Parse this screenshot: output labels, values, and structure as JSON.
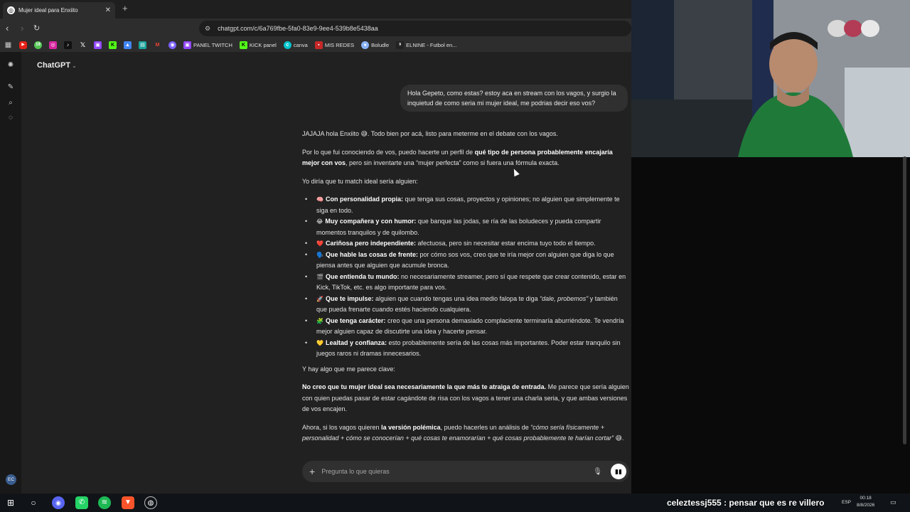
{
  "browser": {
    "tab_title": "Mujer ideal para Enxiito",
    "url": "chatgpt.com/c/6a769fbe-5fa0-83e9-9ee4-539b8e5438aa",
    "bookmarks": [
      {
        "label": "PANEL TWITCH"
      },
      {
        "label": "KICK panel"
      },
      {
        "label": "canva"
      },
      {
        "label": "MIS REDES"
      },
      {
        "label": "Boludle"
      },
      {
        "label": "ELNINE - Futbol en..."
      }
    ],
    "bookmark_icon_badge": "19"
  },
  "chat": {
    "model_name": "ChatGPT",
    "avatar_initials": "EC",
    "user_message": "Hola Gepeto, como estas? estoy aca en stream con los vagos, y surgio la inquietud de como seria mi mujer ideal, me podrias decir eso vos?",
    "answer": {
      "greeting": "JAJAJA hola Enxiito 😅. Todo bien por acá, listo para meterme en el debate con los vagos.",
      "intro_pre": "Por lo que fui conociendo de vos, puedo hacerte un perfil de ",
      "intro_bold": "qué tipo de persona probablemente encajaría mejor con vos",
      "intro_post": ", pero sin inventarte una “mujer perfecta” como si fuera una fórmula exacta.",
      "lead": "Yo diría que tu match ideal sería alguien:",
      "items": [
        {
          "emoji": "🧠",
          "title": "Con personalidad propia:",
          "text": " que tenga sus cosas, proyectos y opiniones; no alguien que simplemente te siga en todo."
        },
        {
          "emoji": "😂",
          "title": "Muy compañera y con humor:",
          "text": " que banque las jodas, se ría de las boludeces y pueda compartir momentos tranquilos y de quilombo."
        },
        {
          "emoji": "❤️",
          "title": "Cariñosa pero independiente:",
          "text": " afectuosa, pero sin necesitar estar encima tuyo todo el tiempo."
        },
        {
          "emoji": "🗣️",
          "title": "Que hable las cosas de frente:",
          "text": " por cómo sos vos, creo que te iría mejor con alguien que diga lo que piensa antes que alguien que acumule bronca."
        },
        {
          "emoji": "🎬",
          "title": "Que entienda tu mundo:",
          "text": " no necesariamente streamer, pero sí que respete que crear contenido, estar en Kick, TikTok, etc. es algo importante para vos."
        },
        {
          "emoji": "🚀",
          "title": "Que te impulse:",
          "text": " alguien que cuando tengas una idea medio falopa te diga ",
          "italic": "“dale, probemos”",
          "text2": " y también que pueda frenarte cuando estés haciendo cualquiera."
        },
        {
          "emoji": "🧩",
          "title": "Que tenga carácter:",
          "text": " creo que una persona demasiado complaciente terminaría aburriéndote. Te vendría mejor alguien capaz de discutirte una idea y hacerte pensar."
        },
        {
          "emoji": "💛",
          "title": "Lealtad y confianza:",
          "text": " esto probablemente sería de las cosas más importantes. Poder estar tranquilo sin juegos raros ni dramas innecesarios."
        }
      ],
      "key_line": "Y hay algo que me parece clave:",
      "key_bold": "No creo que tu mujer ideal sea necesariamente la que más te atraiga de entrada.",
      "key_rest": " Me parece que sería alguien con quien puedas pasar de estar cagándote de risa con los vagos a tener una charla seria, y que ambas versiones de vos encajen.",
      "closing_pre": "Ahora, si los vagos quieren ",
      "closing_bold": "la versión polémica",
      "closing_mid": ", puedo hacerles un análisis de ",
      "closing_italic": "“cómo sería físicamente + personalidad + cómo se conocerían + qué cosas te enamorarían + qué cosas probablemente te harían cortar”",
      "closing_end": " 😅."
    },
    "composer_placeholder": "Pregunta lo que quieras"
  },
  "taskbar": {
    "chat_overlay": "celeztessj555 : pensar que es re villero",
    "language": "ESP",
    "time": "00:18",
    "date": "8/8/2026"
  }
}
